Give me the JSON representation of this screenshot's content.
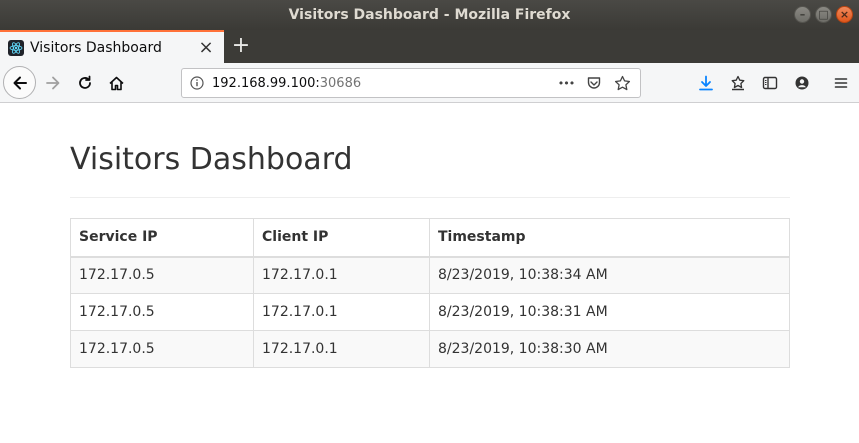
{
  "window": {
    "title": "Visitors Dashboard - Mozilla Firefox"
  },
  "tab": {
    "title": "Visitors Dashboard",
    "close_glyph": "×",
    "new_tab_glyph": "+"
  },
  "toolbar": {
    "url_host": "192.168.99.100:",
    "url_port": "30686",
    "more_glyph": "•••"
  },
  "page": {
    "heading": "Visitors Dashboard",
    "table": {
      "headers": [
        "Service IP",
        "Client IP",
        "Timestamp"
      ],
      "rows": [
        [
          "172.17.0.5",
          "172.17.0.1",
          "8/23/2019, 10:38:34 AM"
        ],
        [
          "172.17.0.5",
          "172.17.0.1",
          "8/23/2019, 10:38:31 AM"
        ],
        [
          "172.17.0.5",
          "172.17.0.1",
          "8/23/2019, 10:38:30 AM"
        ]
      ]
    }
  },
  "colors": {
    "tab_accent": "#ff7139",
    "download_icon": "#0a84ff",
    "titlebar": "#3b3a36",
    "react_logo": "#61dafb"
  }
}
